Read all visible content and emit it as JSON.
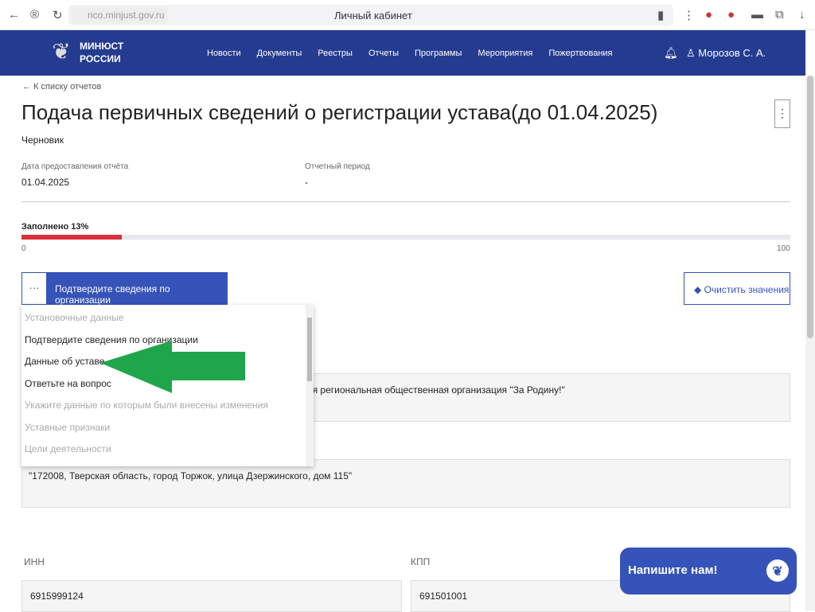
{
  "browser": {
    "url": "nco.minjust.gov.ru",
    "title": "Личный кабинет"
  },
  "nav": {
    "brand_line1": "МИНЮСТ",
    "brand_line2": "РОССИИ",
    "items": [
      "Новости",
      "Документы",
      "Реестры",
      "Отчеты",
      "Программы",
      "Мероприятия",
      "Пожертвования"
    ],
    "user": "Морозов С. А."
  },
  "page": {
    "back": "← К списку отчетов",
    "title": "Подача первичных сведений о регистрации устава(до 01.04.2025)",
    "status": "Черновик",
    "date_label": "Дата предоставления отчёта",
    "date_value": "01.04.2025",
    "period_label": "Отчетный период",
    "period_value": "-"
  },
  "progress": {
    "label": "Заполнено 13%",
    "value": 13,
    "min": "0",
    "max": "100"
  },
  "section": {
    "dots": "···",
    "current": "Подтвердите сведения по организации",
    "clear": "Очистить значения"
  },
  "dropdown": [
    {
      "label": "Установочные данные",
      "disabled": true
    },
    {
      "label": "Подтвердите сведения по организации",
      "disabled": false
    },
    {
      "label": "Данные об уставе",
      "disabled": false
    },
    {
      "label": "Ответьте на вопрос",
      "disabled": false
    },
    {
      "label": "Укажите данные по которым были внесены изменения",
      "disabled": true
    },
    {
      "label": "Уставные признаки",
      "disabled": true
    },
    {
      "label": "Цели деятельности",
      "disabled": true
    }
  ],
  "fields": {
    "org_name": "овая региональная общественная организация \"За Родину!\"",
    "address": "\"172008, Тверская область, город Торжок, улица Дзержинского, дом 115\"",
    "inn_label": "ИНН",
    "inn": "6915999124",
    "kpp_label": "КПП",
    "kpp": "691501001"
  },
  "chat": {
    "label": "Напишите нам!"
  },
  "colors": {
    "brand": "#243b90",
    "accent": "#3553b8",
    "progress": "#d9303e",
    "arrow": "#1fa54a"
  }
}
